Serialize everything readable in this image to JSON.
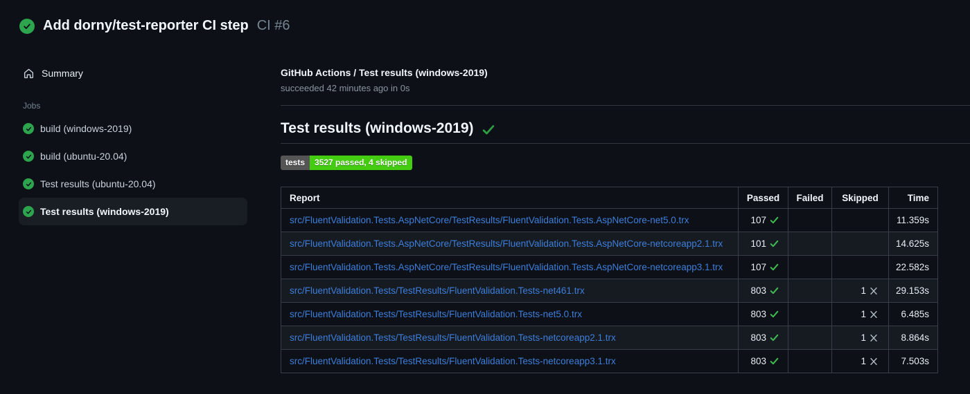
{
  "header": {
    "title": "Add dorny/test-reporter CI step",
    "run_number": "CI #6"
  },
  "sidebar": {
    "summary_label": "Summary",
    "jobs_label": "Jobs",
    "jobs": [
      {
        "label": "build (windows-2019)",
        "status": "success",
        "selected": false
      },
      {
        "label": "build (ubuntu-20.04)",
        "status": "success",
        "selected": false
      },
      {
        "label": "Test results (ubuntu-20.04)",
        "status": "success",
        "selected": false
      },
      {
        "label": "Test results (windows-2019)",
        "status": "success",
        "selected": true
      }
    ]
  },
  "job_header": {
    "title": "GitHub Actions / Test results (windows-2019)",
    "status_line": "succeeded 42 minutes ago in 0s"
  },
  "section": {
    "heading": "Test results (windows-2019)",
    "badge": {
      "label": "tests",
      "value": "3527 passed, 4 skipped",
      "label_bg": "#555555",
      "value_bg": "#44cc11"
    }
  },
  "table": {
    "columns": [
      "Report",
      "Passed",
      "Failed",
      "Skipped",
      "Time"
    ],
    "rows": [
      {
        "report": "src/FluentValidation.Tests.AspNetCore/TestResults/FluentValidation.Tests.AspNetCore-net5.0.trx",
        "passed": "107",
        "failed": "",
        "skipped": "",
        "time": "11.359s"
      },
      {
        "report": "src/FluentValidation.Tests.AspNetCore/TestResults/FluentValidation.Tests.AspNetCore-netcoreapp2.1.trx",
        "passed": "101",
        "failed": "",
        "skipped": "",
        "time": "14.625s"
      },
      {
        "report": "src/FluentValidation.Tests.AspNetCore/TestResults/FluentValidation.Tests.AspNetCore-netcoreapp3.1.trx",
        "passed": "107",
        "failed": "",
        "skipped": "",
        "time": "22.582s"
      },
      {
        "report": "src/FluentValidation.Tests/TestResults/FluentValidation.Tests-net461.trx",
        "passed": "803",
        "failed": "",
        "skipped": "1",
        "time": "29.153s"
      },
      {
        "report": "src/FluentValidation.Tests/TestResults/FluentValidation.Tests-net5.0.trx",
        "passed": "803",
        "failed": "",
        "skipped": "1",
        "time": "6.485s"
      },
      {
        "report": "src/FluentValidation.Tests/TestResults/FluentValidation.Tests-netcoreapp2.1.trx",
        "passed": "803",
        "failed": "",
        "skipped": "1",
        "time": "8.864s"
      },
      {
        "report": "src/FluentValidation.Tests/TestResults/FluentValidation.Tests-netcoreapp3.1.trx",
        "passed": "803",
        "failed": "",
        "skipped": "1",
        "time": "7.503s"
      }
    ]
  },
  "colors": {
    "background": "#0d1117",
    "success_disc_green": "#2da44e",
    "check_green": "#3fb950",
    "heading_check_green": "#2ea043",
    "link_blue": "#3d7edb",
    "badge_label_bg": "#555555",
    "badge_value_bg": "#44cc11",
    "muted_text": "#768390",
    "table_border": "#373e47"
  }
}
